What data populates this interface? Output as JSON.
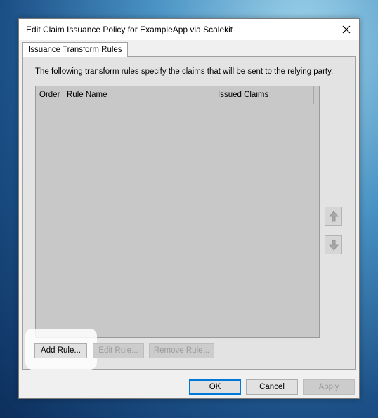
{
  "window": {
    "title": "Edit Claim Issuance Policy for ExampleApp via Scalekit"
  },
  "tabs": [
    {
      "label": "Issuance Transform Rules"
    }
  ],
  "panel": {
    "description": "The following transform rules specify the claims that will be sent to the relying party.",
    "columns": [
      "Order",
      "Rule Name",
      "Issued Claims"
    ]
  },
  "rule_buttons": {
    "add": "Add Rule...",
    "edit": "Edit Rule...",
    "remove": "Remove Rule..."
  },
  "dialog_buttons": {
    "ok": "OK",
    "cancel": "Cancel",
    "apply": "Apply"
  },
  "icons": {
    "close": "close-icon",
    "move_up": "arrow-up-icon",
    "move_down": "arrow-down-icon"
  },
  "colors": {
    "accent": "#0078d7",
    "list_bg": "#c8c8c8",
    "panel_bg": "#e3e3e3"
  }
}
